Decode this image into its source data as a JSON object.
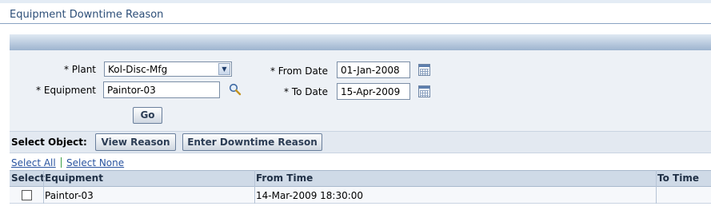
{
  "page": {
    "title": "Equipment Downtime Reason"
  },
  "form": {
    "plant_label": "Plant",
    "plant_value": "Kol-Disc-Mfg",
    "equipment_label": "Equipment",
    "equipment_value": "Paintor-03",
    "from_date_label": "From Date",
    "from_date_value": "01-Jan-2008",
    "to_date_label": "To Date",
    "to_date_value": "15-Apr-2009",
    "required_marker": "*",
    "go_label": "Go"
  },
  "toolbar": {
    "select_object_label": "Select Object:",
    "view_reason_label": "View Reason",
    "enter_downtime_label": "Enter Downtime Reason"
  },
  "selection": {
    "select_all": "Select All",
    "select_none": "Select None"
  },
  "table": {
    "columns": [
      "Select",
      "Equipment",
      "From Time",
      "To Time"
    ],
    "rows": [
      {
        "checked": false,
        "equipment": "Paintor-03",
        "from_time": "14-Mar-2009 18:30:00",
        "to_time": ""
      }
    ]
  },
  "icons": {
    "plant_dropdown": "chevron-down-icon",
    "equipment_search": "search-icon",
    "from_date_picker": "calendar-icon",
    "to_date_picker": "calendar-icon"
  },
  "colors": {
    "title": "#2c4e78",
    "link": "#2a54a0",
    "header_bar": "#9db4cf",
    "panel": "#edf1f6"
  }
}
